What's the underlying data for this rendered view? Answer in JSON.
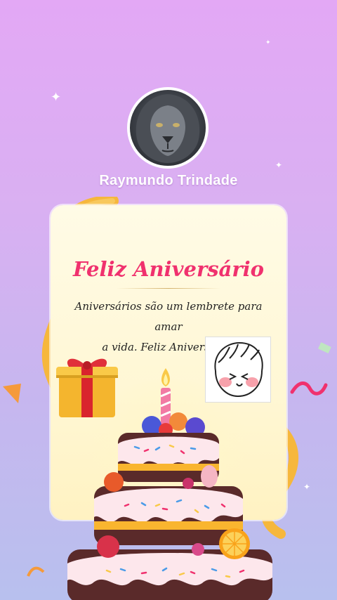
{
  "profile": {
    "name": "Raymundo Trindade",
    "avatar_icon": "lion-avatar-icon"
  },
  "card": {
    "title": "Feliz Aniversário",
    "message_line1": "Aniversários são um lembrete para amar",
    "message_line2": "a vida. Feliz Aniversário!"
  },
  "colors": {
    "title": "#f0316e",
    "background_top": "#e3a8f5",
    "background_bottom": "#b8c0ee",
    "card": "#fff7d4"
  },
  "decorations": [
    "gift-icon",
    "cartoon-face-icon",
    "birthday-cake-icon",
    "confetti-ribbon-icon",
    "sparkle-icon"
  ]
}
